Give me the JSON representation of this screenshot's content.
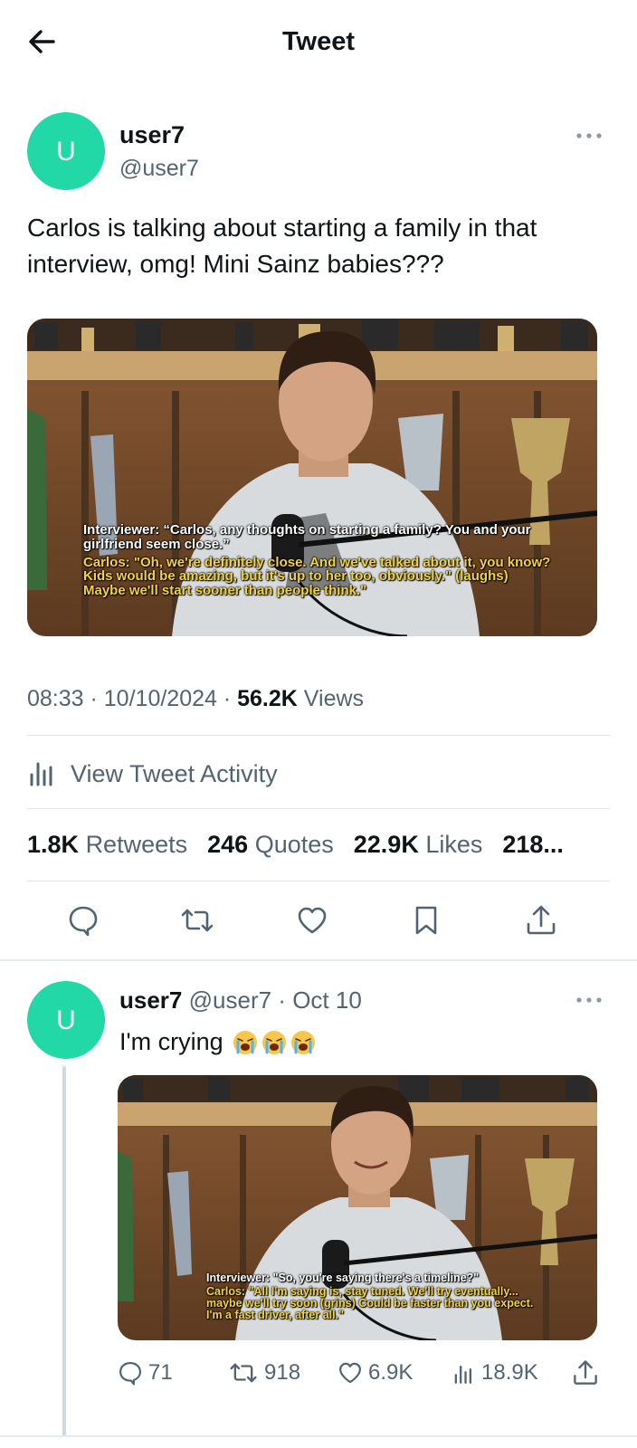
{
  "header": {
    "title": "Tweet"
  },
  "tweet": {
    "display_name": "user7",
    "handle": "@user7",
    "avatar_letter": "U",
    "text": "Carlos is talking about starting a family in that interview, omg! Mini Sainz babies???",
    "media_caption": {
      "interviewer": "Interviewer: “Carlos, any thoughts on starting a family? You and your girlfriend seem close.”",
      "carlos": "Carlos: \"Oh, we're definitely close. And we've talked about it, you know? Kids would be amazing, but it's up to her too, obviously.\" (laughs) Maybe we'll start sooner than people think.\""
    },
    "time": "08:33",
    "date": "10/10/2024",
    "views_count": "56.2K",
    "views_label": "Views",
    "activity_label": "View Tweet Activity",
    "stats": {
      "retweets_count": "1.8K",
      "retweets_label": "Retweets",
      "quotes_count": "246",
      "quotes_label": "Quotes",
      "likes_count": "22.9K",
      "likes_label": "Likes",
      "bookmarks_count": "218..."
    }
  },
  "reply": {
    "display_name": "user7",
    "handle": "@user7",
    "separator": "·",
    "date": "Oct 10",
    "avatar_letter": "U",
    "text": "I'm crying",
    "emoji": [
      "loudly-crying-face",
      "loudly-crying-face",
      "loudly-crying-face"
    ],
    "media_caption": {
      "interviewer": "Interviewer: \"So, you're saying there's a timeline?\"",
      "carlos": "Carlos: \"All I'm saying is, stay tuned. We'll try eventually... maybe we'll try soon (grins) Could be faster than you expect. I'm a fast driver, after all.\""
    },
    "replies_count": "71",
    "retweets_count": "918",
    "likes_count": "6.9K",
    "views_count": "18.9K"
  },
  "icons": {
    "back": "arrow-left-icon",
    "more": "more-horizontal-icon",
    "activity": "bar-chart-icon",
    "reply": "comment-icon",
    "retweet": "retweet-icon",
    "like": "heart-icon",
    "bookmark": "bookmark-icon",
    "share": "share-icon"
  },
  "colors": {
    "avatar": "#21d8a6",
    "secondary_text": "#536471",
    "caption_yellow": "#f5d33b"
  }
}
